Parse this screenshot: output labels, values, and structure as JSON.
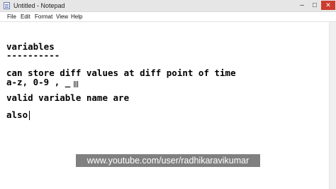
{
  "window": {
    "title": "Untitled - Notepad",
    "buttons": {
      "minimize_icon": "minimize-icon",
      "maximize_icon": "maximize-icon",
      "close_icon": "close-icon",
      "close_color": "#cc3d2f"
    }
  },
  "menu": {
    "file": "File",
    "edit": "Edit",
    "format": "Format",
    "view": "View",
    "help": "Help"
  },
  "editor": {
    "lines": [
      "variables",
      "----------",
      "can store diff values at diff point of time",
      "a-z, 0-9 , _",
      "valid variable name are",
      "also"
    ],
    "cursor": "ibeam-cursor-icon"
  },
  "watermark": {
    "text": "www.youtube.com/user/radhikaravikumar"
  }
}
